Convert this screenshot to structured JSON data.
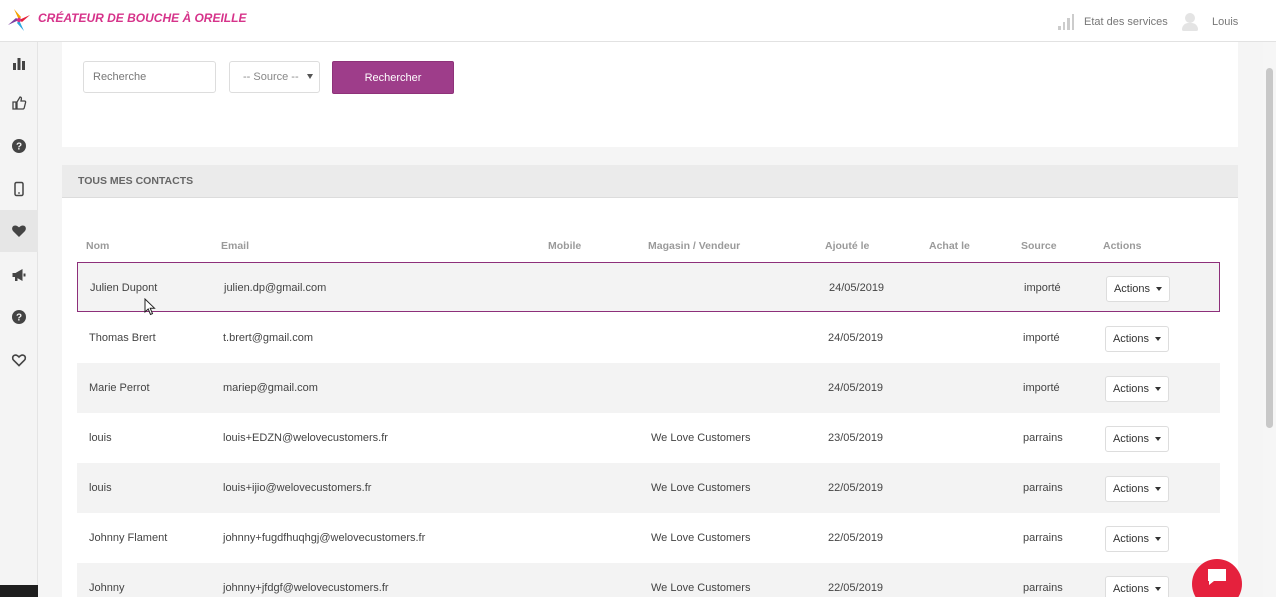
{
  "header": {
    "brand": "Créateur de bouche à oreille",
    "status_label": "Etat des services",
    "user_name": "Louis"
  },
  "sidebar": {
    "items": [
      {
        "icon": "bar-chart-icon"
      },
      {
        "icon": "thumbs-up-icon"
      },
      {
        "icon": "help-circle-icon"
      },
      {
        "icon": "mobile-icon"
      },
      {
        "icon": "heart-icon",
        "active": true
      },
      {
        "icon": "megaphone-icon"
      },
      {
        "icon": "help-circle-icon"
      },
      {
        "icon": "heart-outline-icon"
      }
    ]
  },
  "search": {
    "placeholder": "Recherche",
    "source_selected": "-- Source --",
    "button_label": "Rechercher"
  },
  "contacts": {
    "title": "TOUS MES CONTACTS",
    "columns": {
      "nom": "Nom",
      "email": "Email",
      "mobile": "Mobile",
      "magasin": "Magasin / Vendeur",
      "ajoute": "Ajouté le",
      "achat": "Achat le",
      "source": "Source",
      "actions": "Actions"
    },
    "rows": [
      {
        "nom": "Julien Dupont",
        "email": "julien.dp@gmail.com",
        "mobile": "",
        "magasin": "",
        "ajoute": "24/05/2019",
        "achat": "",
        "source": "importé",
        "action_label": "Actions"
      },
      {
        "nom": "Thomas Brert",
        "email": "t.brert@gmail.com",
        "mobile": "",
        "magasin": "",
        "ajoute": "24/05/2019",
        "achat": "",
        "source": "importé",
        "action_label": "Actions"
      },
      {
        "nom": "Marie Perrot",
        "email": "mariep@gmail.com",
        "mobile": "",
        "magasin": "",
        "ajoute": "24/05/2019",
        "achat": "",
        "source": "importé",
        "action_label": "Actions"
      },
      {
        "nom": "louis",
        "email": "louis+EDZN@welovecustomers.fr",
        "mobile": "",
        "magasin": "We Love Customers",
        "ajoute": "23/05/2019",
        "achat": "",
        "source": "parrains",
        "action_label": "Actions"
      },
      {
        "nom": "louis",
        "email": "louis+ijio@welovecustomers.fr",
        "mobile": "",
        "magasin": "We Love Customers",
        "ajoute": "22/05/2019",
        "achat": "",
        "source": "parrains",
        "action_label": "Actions"
      },
      {
        "nom": "Johnny Flament",
        "email": "johnny+fugdfhuqhgj@welovecustomers.fr",
        "mobile": "",
        "magasin": "We Love Customers",
        "ajoute": "22/05/2019",
        "achat": "",
        "source": "parrains",
        "action_label": "Actions"
      },
      {
        "nom": "Johnny",
        "email": "johnny+jfdgf@welovecustomers.fr",
        "mobile": "",
        "magasin": "We Love Customers",
        "ajoute": "22/05/2019",
        "achat": "",
        "source": "parrains",
        "action_label": "Actions"
      }
    ]
  },
  "colors": {
    "brand": "#d6338a",
    "button": "#9e3d8a",
    "selected_border": "#8d2f7a",
    "chat": "#e5213d"
  }
}
